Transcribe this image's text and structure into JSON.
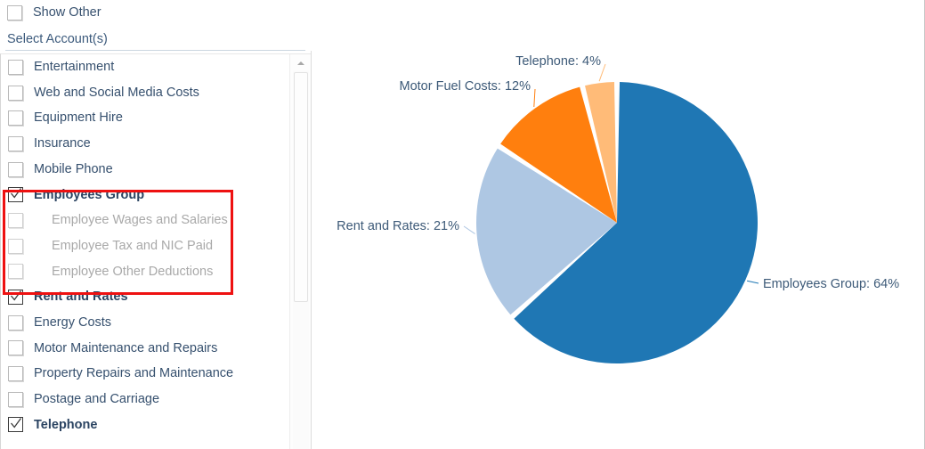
{
  "panel": {
    "show_other_label": "Show Other",
    "select_accounts_label": "Select Account(s)",
    "scrollbar_up_icon": "chevron-up-icon"
  },
  "accounts": [
    {
      "label": "Entertainment",
      "checked": false,
      "bold": false,
      "dim": false,
      "indent": false
    },
    {
      "label": "Web and Social Media Costs",
      "checked": false,
      "bold": false,
      "dim": false,
      "indent": false
    },
    {
      "label": "Equipment Hire",
      "checked": false,
      "bold": false,
      "dim": false,
      "indent": false
    },
    {
      "label": "Insurance",
      "checked": false,
      "bold": false,
      "dim": false,
      "indent": false
    },
    {
      "label": "Mobile Phone",
      "checked": false,
      "bold": false,
      "dim": false,
      "indent": false
    },
    {
      "label": "Employees Group",
      "checked": true,
      "bold": true,
      "dim": false,
      "indent": false
    },
    {
      "label": "Employee Wages and Salaries",
      "checked": false,
      "bold": false,
      "dim": true,
      "indent": true
    },
    {
      "label": "Employee Tax and NIC Paid",
      "checked": false,
      "bold": false,
      "dim": true,
      "indent": true
    },
    {
      "label": "Employee Other Deductions",
      "checked": false,
      "bold": false,
      "dim": true,
      "indent": true
    },
    {
      "label": "Rent and Rates",
      "checked": true,
      "bold": true,
      "dim": false,
      "indent": false
    },
    {
      "label": "Energy Costs",
      "checked": false,
      "bold": false,
      "dim": false,
      "indent": false
    },
    {
      "label": "Motor Maintenance and Repairs",
      "checked": false,
      "bold": false,
      "dim": false,
      "indent": false
    },
    {
      "label": "Property Repairs and Maintenance",
      "checked": false,
      "bold": false,
      "dim": false,
      "indent": false
    },
    {
      "label": "Postage and Carriage",
      "checked": false,
      "bold": false,
      "dim": false,
      "indent": false
    },
    {
      "label": "Telephone",
      "checked": true,
      "bold": true,
      "dim": false,
      "indent": false
    }
  ],
  "highlight": {
    "color": "#ee1111",
    "covers": [
      "Employees Group",
      "Employee Wages and Salaries",
      "Employee Tax and NIC Paid",
      "Employee Other Deductions"
    ]
  },
  "chart_data": {
    "type": "pie",
    "title": "",
    "legend_position": "labels-outside",
    "label_format": "{name}: {percent}%",
    "categories": [
      "Employees Group",
      "Rent and Rates",
      "Motor Fuel Costs",
      "Telephone"
    ],
    "values": [
      64,
      21,
      12,
      4
    ],
    "colors": [
      "#1f77b4",
      "#aec7e3",
      "#ff7f0e",
      "#ffbb78"
    ],
    "labels": [
      {
        "text": "Employees Group: 64%",
        "color": "#3d5a78"
      },
      {
        "text": "Rent and Rates: 21%",
        "color": "#3d5a78"
      },
      {
        "text": "Motor Fuel Costs: 12%",
        "color": "#3d5a78"
      },
      {
        "text": "Telephone: 4%",
        "color": "#3d5a78"
      }
    ]
  }
}
